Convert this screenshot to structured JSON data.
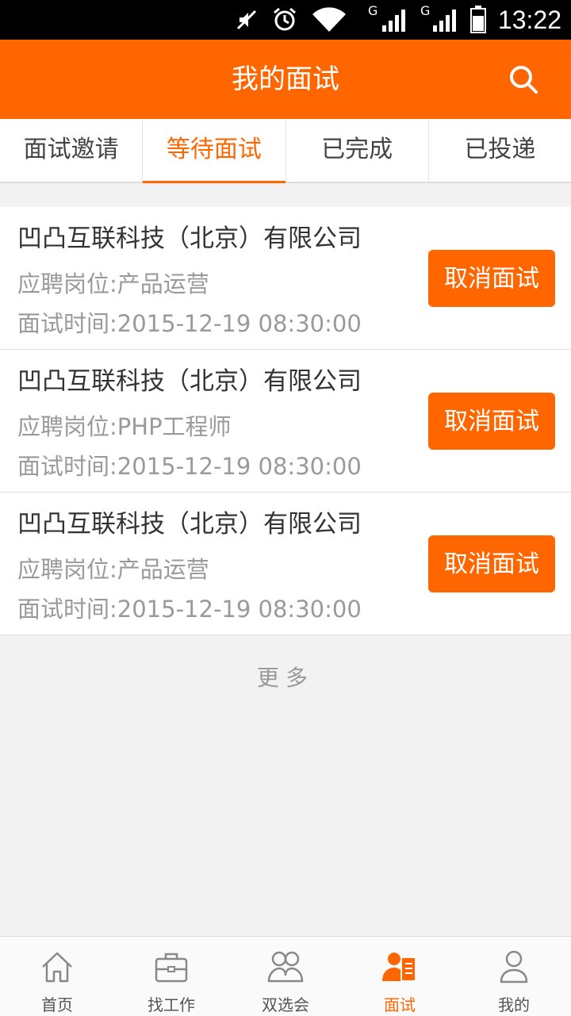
{
  "status_bar": {
    "time": "13:22",
    "icons": [
      "mute-icon",
      "alarm-icon",
      "wifi-icon",
      "signal-icon",
      "signal-icon",
      "battery-icon"
    ],
    "network_type": "G"
  },
  "header": {
    "title": "我的面试",
    "search_icon": "search-icon"
  },
  "tabs": [
    {
      "label": "面试邀请",
      "active": false
    },
    {
      "label": "等待面试",
      "active": true
    },
    {
      "label": "已完成",
      "active": false
    },
    {
      "label": "已投递",
      "active": false
    }
  ],
  "interviews": [
    {
      "company": "凹凸互联科技（北京）有限公司",
      "position": "应聘岗位:产品运营",
      "time": "面试时间:2015-12-19 08:30:00",
      "button": "取消面试"
    },
    {
      "company": "凹凸互联科技（北京）有限公司",
      "position": "应聘岗位:PHP工程师",
      "time": "面试时间:2015-12-19 08:30:00",
      "button": "取消面试"
    },
    {
      "company": "凹凸互联科技（北京）有限公司",
      "position": "应聘岗位:产品运营",
      "time": "面试时间:2015-12-19 08:30:00",
      "button": "取消面试"
    }
  ],
  "more_label": "更多",
  "bottom_nav": [
    {
      "label": "首页",
      "icon": "home-icon",
      "active": false
    },
    {
      "label": "找工作",
      "icon": "briefcase-icon",
      "active": false
    },
    {
      "label": "双选会",
      "icon": "people-icon",
      "active": false
    },
    {
      "label": "面试",
      "icon": "interview-icon",
      "active": true
    },
    {
      "label": "我的",
      "icon": "profile-icon",
      "active": false
    }
  ],
  "colors": {
    "accent": "#ff6600",
    "background": "#f2f2f2",
    "text_primary": "#333333",
    "text_secondary": "#9a9a9a"
  }
}
